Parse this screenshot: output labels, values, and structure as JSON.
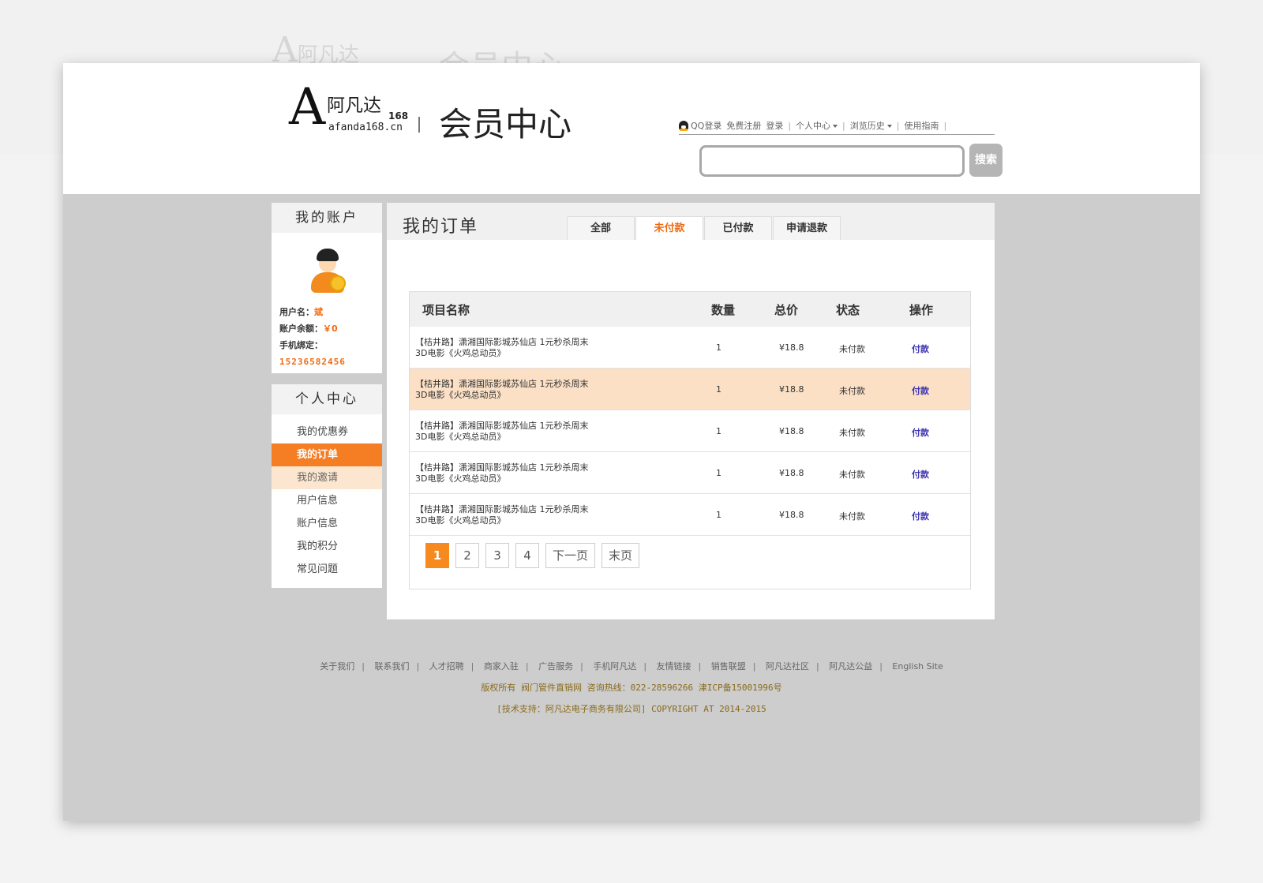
{
  "brand": {
    "logo_letter": "A",
    "logo_name": "阿凡达",
    "logo_168": "168",
    "logo_url": "afanda168.cn",
    "page_title": "会员中心"
  },
  "topnav": {
    "qq_login": "QQ登录",
    "register": "免费注册",
    "login": "登录",
    "personal_center": "个人中心",
    "browse_history": "浏览历史",
    "guide": "使用指南"
  },
  "search": {
    "button_label": "搜索",
    "placeholder": ""
  },
  "account": {
    "title": "我的账户",
    "username_label": "用户名：",
    "username_value": "斌",
    "balance_label": "账户余额：",
    "balance_value": "￥0",
    "phone_label": "手机绑定：",
    "phone_value": "15236582456"
  },
  "menu": {
    "title": "个人中心",
    "items": [
      "我的优惠券",
      "我的订单",
      "我的邀请",
      "用户信息",
      "账户信息",
      "我的积分",
      "常见问题"
    ]
  },
  "orders": {
    "title": "我的订单",
    "tabs": [
      "全部",
      "未付款",
      "已付款",
      "申请退款"
    ],
    "columns": [
      "项目名称",
      "数量",
      "总价",
      "状态",
      "操作"
    ],
    "rows": [
      {
        "name1": "【桔井路】潇湘国际影城苏仙店 1元秒杀周末",
        "name2": "3D电影《火鸡总动员》",
        "qty": "1",
        "price": "¥18.8",
        "status": "未付款",
        "action": "付款"
      },
      {
        "name1": "【桔井路】潇湘国际影城苏仙店 1元秒杀周末",
        "name2": "3D电影《火鸡总动员》",
        "qty": "1",
        "price": "¥18.8",
        "status": "未付款",
        "action": "付款"
      },
      {
        "name1": "【桔井路】潇湘国际影城苏仙店 1元秒杀周末",
        "name2": "3D电影《火鸡总动员》",
        "qty": "1",
        "price": "¥18.8",
        "status": "未付款",
        "action": "付款"
      },
      {
        "name1": "【桔井路】潇湘国际影城苏仙店 1元秒杀周末",
        "name2": "3D电影《火鸡总动员》",
        "qty": "1",
        "price": "¥18.8",
        "status": "未付款",
        "action": "付款"
      },
      {
        "name1": "【桔井路】潇湘国际影城苏仙店 1元秒杀周末",
        "name2": "3D电影《火鸡总动员》",
        "qty": "1",
        "price": "¥18.8",
        "status": "未付款",
        "action": "付款"
      }
    ],
    "pager": [
      "1",
      "2",
      "3",
      "4",
      "下一页",
      "末页"
    ]
  },
  "footer": {
    "links": [
      "关于我们",
      "联系我们",
      "人才招聘",
      "商家入驻",
      "广告服务",
      "手机阿凡达",
      "友情链接",
      "销售联盟",
      "阿凡达社区",
      "阿凡达公益",
      "English Site"
    ],
    "copyright": "版权所有 阀门管件直销网 咨询热线：022-28596266 津ICP备15001996号",
    "tech": "[技术支持：阿凡达电子商务有限公司] COPYRIGHT AT 2014-2015"
  },
  "colors": {
    "accent": "#f57d23",
    "highlight_row": "#fbe0c6",
    "frame_bg": "#cdcdcd"
  }
}
